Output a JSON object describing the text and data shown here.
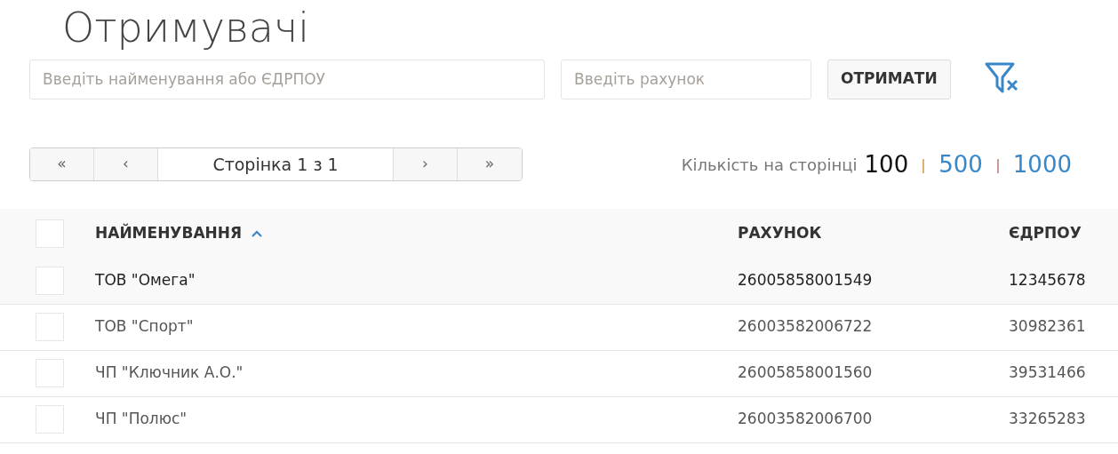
{
  "title": "Отримувачі",
  "search": {
    "name_placeholder": "Введіть найменування або ЄДРПОУ",
    "account_placeholder": "Введіть рахунок",
    "submit": "ОТРИМАТИ"
  },
  "pager": {
    "first": "«",
    "prev": "‹",
    "page": "Сторінка 1 з 1",
    "next": "›",
    "last": "»"
  },
  "page_size": {
    "label": "Кількість на сторінці",
    "options": [
      {
        "label": "100",
        "selected": true
      },
      {
        "label": "500",
        "selected": false
      },
      {
        "label": "1000",
        "selected": false
      }
    ]
  },
  "table": {
    "columns": [
      {
        "label": "НАЙМЕНУВАННЯ",
        "sorted": true
      },
      {
        "label": "РАХУНОК",
        "sorted": false
      },
      {
        "label": "ЄДРПОУ",
        "sorted": false
      }
    ],
    "header_checked": false,
    "rows": [
      {
        "name": "ТОВ \"Омега\"",
        "account": "26005858001549",
        "edrpou": "12345678",
        "checked": false,
        "selected": true
      },
      {
        "name": "ТОВ \"Спорт\"",
        "account": "26003582006722",
        "edrpou": "30982361",
        "checked": false,
        "selected": false
      },
      {
        "name": "ЧП \"Ключник А.О.\"",
        "account": "26005858001560",
        "edrpou": "39531466",
        "checked": false,
        "selected": false
      },
      {
        "name": "ЧП \"Полюс\"",
        "account": "26003582006700",
        "edrpou": "33265283",
        "checked": false,
        "selected": false
      }
    ]
  }
}
